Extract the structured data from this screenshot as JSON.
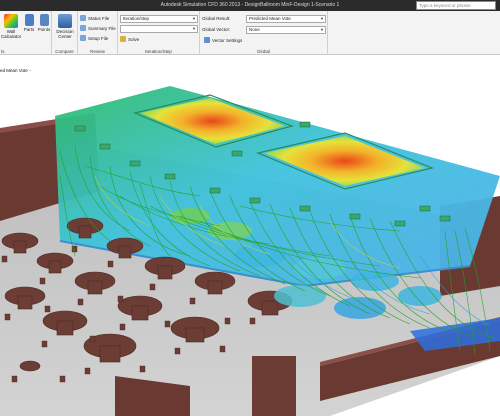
{
  "window": {
    "title": "Autodesk Simulation CFD 360 2013 - DesignBallroom MinF-Design 1-Scenario 1",
    "search_placeholder": "Type a keyword or phrase"
  },
  "ribbon": {
    "buttons": {
      "wall_calculator": "Wall Calculator",
      "parts": "Parts",
      "points": "Points",
      "decision_center": "Decision Center"
    },
    "review": {
      "status_file": "Status File",
      "summary_file": "Summary File",
      "setup_file": "Setup File"
    },
    "iteration": {
      "select_value": "Iteration/step",
      "solve": "Solve"
    },
    "global": {
      "global_result_label": "Global Result:",
      "global_result_value": "Predicted Mean Vote",
      "global_vector_label": "Global Vector:",
      "global_vector_value": "None",
      "vector_settings": "Vector Settings"
    },
    "group_labels": {
      "left_partial": "ts",
      "compare": "Compare",
      "review": "Review",
      "iteration": "Iteration/Step",
      "global": "Global"
    }
  },
  "viewport": {
    "result_label": "ed Mean Vote -"
  },
  "colors": {
    "floor": "#c9c9c9",
    "wall": "#6a3a32",
    "furniture": "#6b3d34",
    "hot": "#e84a1a",
    "cool": "#1c5fd0",
    "streamline": "#1fa31f",
    "ceiling_cyan": "#3fc2dd"
  }
}
